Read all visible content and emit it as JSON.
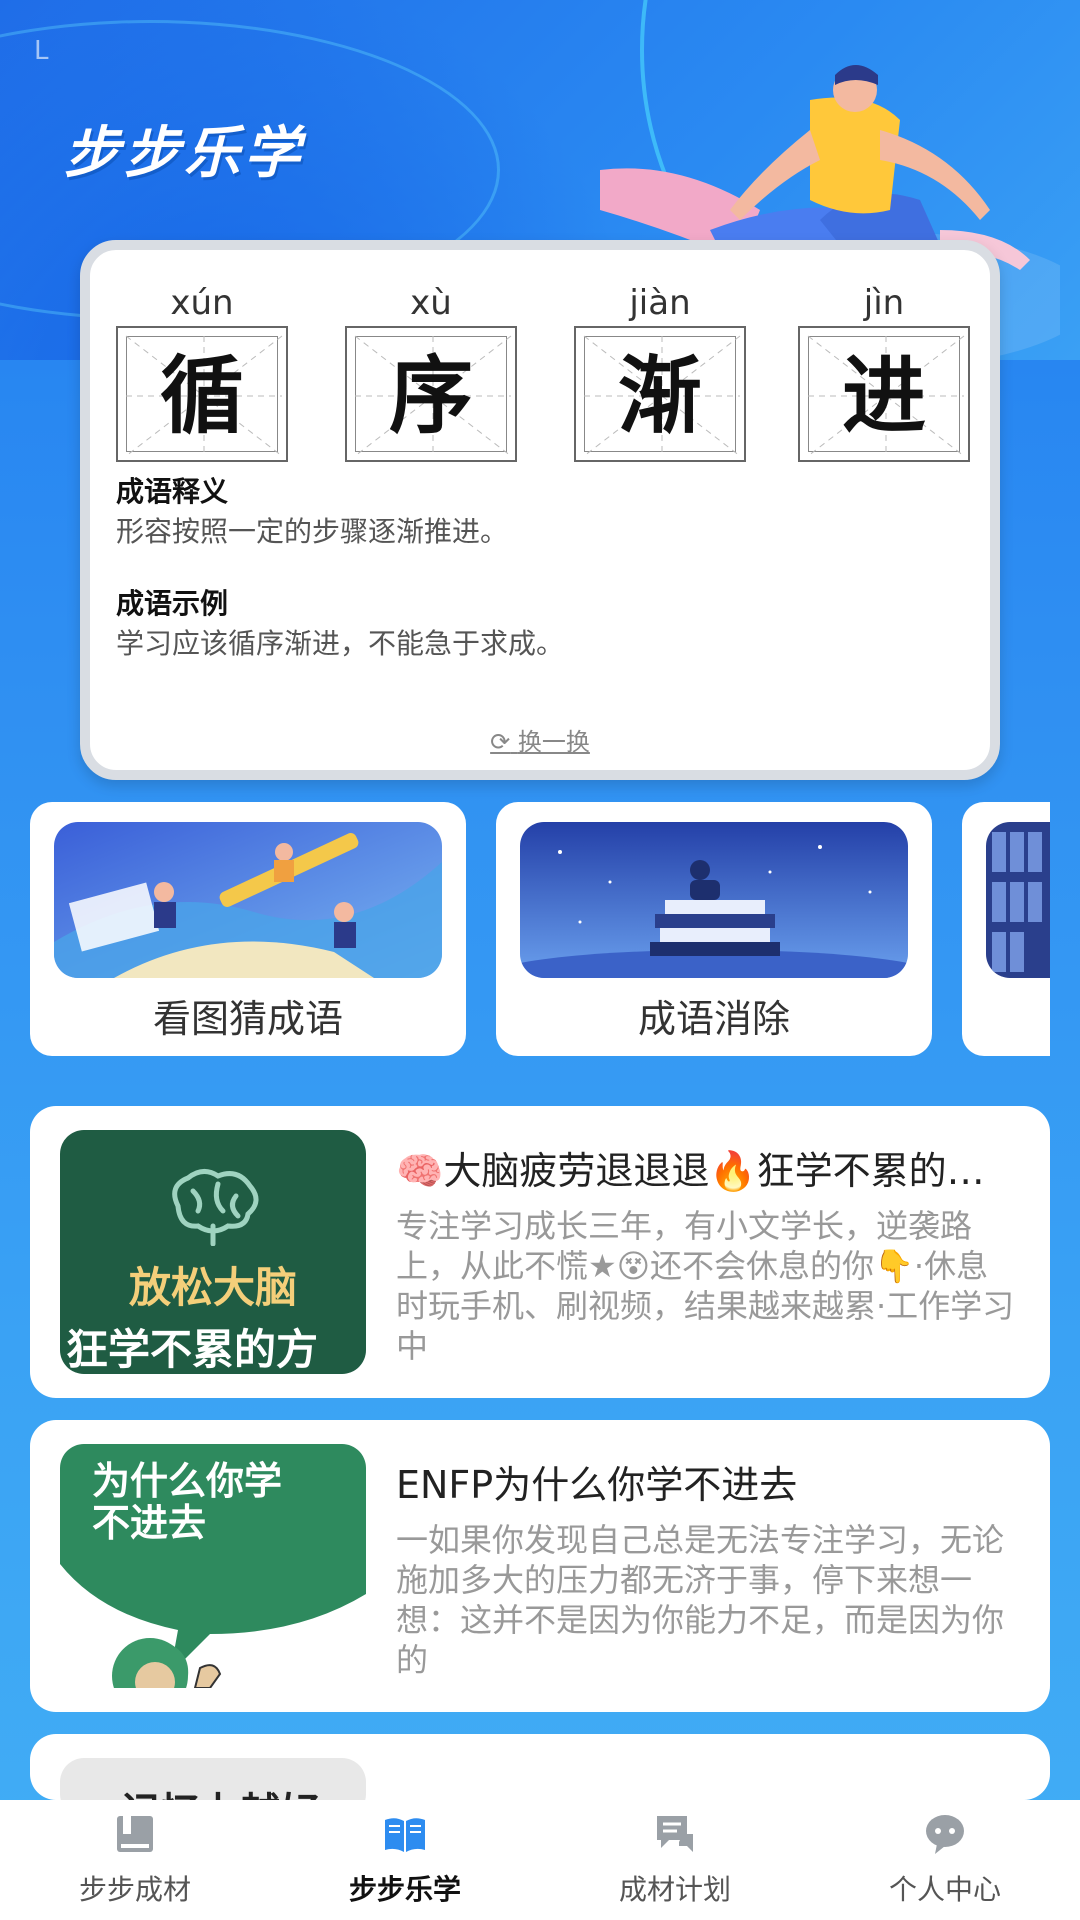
{
  "app": {
    "title": "步步乐学",
    "status_glyph": "L"
  },
  "idiom": {
    "chars": [
      {
        "pinyin": "xún",
        "char": "循"
      },
      {
        "pinyin": "xù",
        "char": "序"
      },
      {
        "pinyin": "jiàn",
        "char": "渐"
      },
      {
        "pinyin": "jìn",
        "char": "进"
      }
    ],
    "meaning_title": "成语释义",
    "meaning_text": "形容按照一定的步骤逐渐推进。",
    "example_title": "成语示例",
    "example_text": "学习应该循序渐进，不能急于求成。",
    "refresh_label": "换一换",
    "refresh_icon": "refresh-icon"
  },
  "games": [
    {
      "label": "看图猜成语",
      "image": "pencil-flight-illustration"
    },
    {
      "label": "成语消除",
      "image": "book-stack-night-illustration"
    },
    {
      "label": "",
      "image": "library-shelf-illustration"
    }
  ],
  "articles": [
    {
      "title": "🧠大脑疲劳退退退🔥狂学不累的方法",
      "body": "专注学习成长三年，有小文学长，逆袭路上，从此不慌★😵还不会休息的你👇·休息时玩手机、刷视频，结果越来越累·工作学习中",
      "thumb_text_1": "放松大脑",
      "thumb_text_2": "狂学不累的方",
      "thumb_icon": "brain-icon"
    },
    {
      "title": "ENFP为什么你学不进去",
      "body": "一如果你发现自己总是无法专注学习，无论施加多大的压力都无济于事，停下来想一想：这并不是因为你能力不足，而是因为你的",
      "thumb_text_1": "为什么你学",
      "thumb_text_2": "不进去"
    }
  ],
  "partial_article": {
    "thumb_text": "记忆力越好"
  },
  "tabs": [
    {
      "label": "步步成材",
      "icon": "book-closed-icon",
      "active": false
    },
    {
      "label": "步步乐学",
      "icon": "book-open-icon",
      "active": true
    },
    {
      "label": "成材计划",
      "icon": "plan-chat-icon",
      "active": false
    },
    {
      "label": "个人中心",
      "icon": "chat-bubble-icon",
      "active": false
    }
  ],
  "colors": {
    "accent": "#1f7cf0",
    "active_tab_icon": "#2d8cf0",
    "inactive_tab_icon": "#9aa0a6",
    "thumb_green": "#1f5c43"
  }
}
